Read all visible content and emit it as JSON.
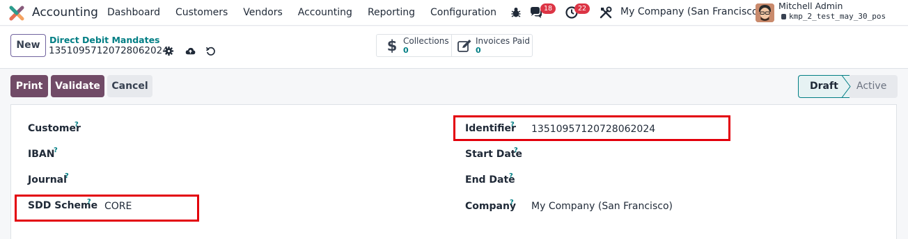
{
  "navbar": {
    "app_name": "Accounting",
    "menu": [
      "Dashboard",
      "Customers",
      "Vendors",
      "Accounting",
      "Reporting",
      "Configuration"
    ],
    "messages_badge": "18",
    "activities_badge": "22",
    "company": "My Company (San Francisco)",
    "user": {
      "name": "Mitchell Admin",
      "database": "kmp_2_test_may_30_pos"
    }
  },
  "control": {
    "new_label": "New",
    "breadcrumb": "Direct Debit Mandates",
    "record_name": "13510957120728062024",
    "smart_buttons": [
      {
        "label": "Collections",
        "value": "0",
        "icon": "dollar-icon"
      },
      {
        "label": "Invoices Paid",
        "value": "0",
        "icon": "edit-icon"
      }
    ]
  },
  "status_bar": {
    "buttons": [
      "Print",
      "Validate",
      "Cancel"
    ],
    "stages": [
      "Draft",
      "Active"
    ],
    "current_stage": "Draft"
  },
  "form": {
    "help_mark": "?",
    "left": [
      {
        "label": "Customer",
        "value": ""
      },
      {
        "label": "IBAN",
        "value": ""
      },
      {
        "label": "Journal",
        "value": ""
      },
      {
        "label": "SDD Scheme",
        "value": "CORE"
      }
    ],
    "right": [
      {
        "label": "Identifier",
        "value": "13510957120728062024"
      },
      {
        "label": "Start Date",
        "value": ""
      },
      {
        "label": "End Date",
        "value": ""
      },
      {
        "label": "Company",
        "value": "My Company (San Francisco)"
      }
    ]
  },
  "colors": {
    "primary": "#714b67",
    "teal": "#017e84",
    "badge": "#dc3545",
    "highlight": "#e3000b"
  }
}
